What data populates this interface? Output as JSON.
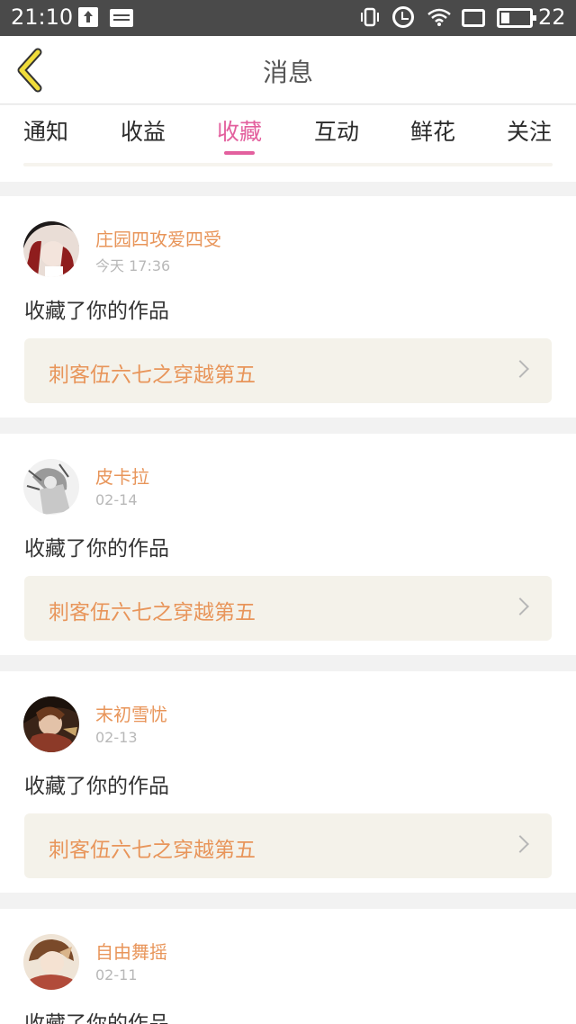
{
  "status_bar": {
    "time": "21:10",
    "battery": "22"
  },
  "header": {
    "title": "消息"
  },
  "tabs": [
    {
      "label": "通知"
    },
    {
      "label": "收益"
    },
    {
      "label": "收藏",
      "active": true
    },
    {
      "label": "互动"
    },
    {
      "label": "鲜花"
    },
    {
      "label": "关注"
    }
  ],
  "messages": [
    {
      "user": "庄园四攻爱四受",
      "time": "今天 17:36",
      "action": "收藏了你的作品",
      "work": "刺客伍六七之穿越第五"
    },
    {
      "user": "皮卡拉",
      "time": "02-14",
      "action": "收藏了你的作品",
      "work": "刺客伍六七之穿越第五"
    },
    {
      "user": "末初雪忧",
      "time": "02-13",
      "action": "收藏了你的作品",
      "work": "刺客伍六七之穿越第五"
    },
    {
      "user": "自由舞摇",
      "time": "02-11",
      "action": "收藏了你的作品",
      "work": ""
    }
  ],
  "colors": {
    "accent": "#e3609e",
    "name": "#e8955a",
    "back_arrow": "#f0dc3a",
    "card_link_bg": "#f4f2ea"
  }
}
